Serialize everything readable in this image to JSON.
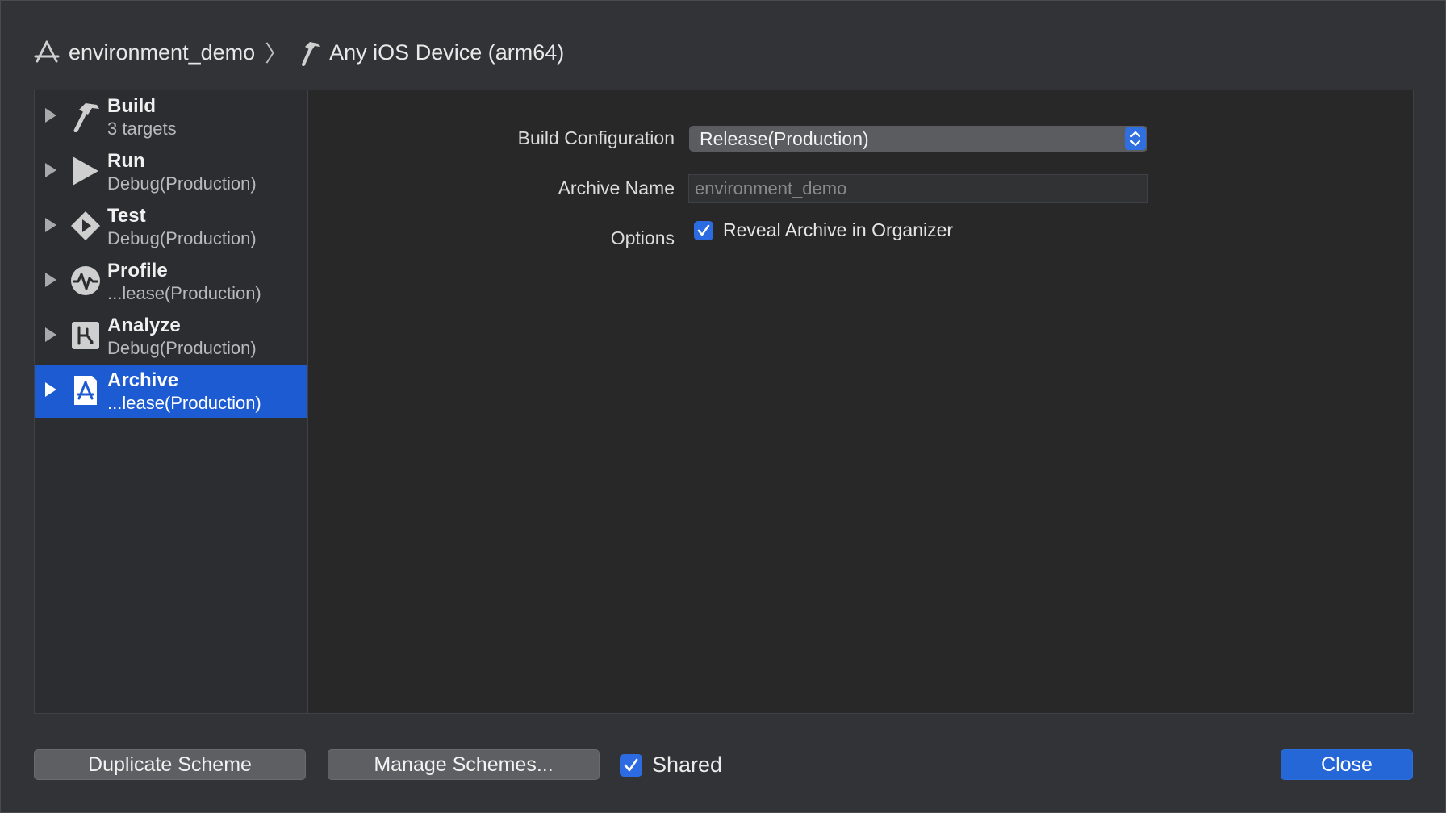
{
  "breadcrumb": {
    "project": "environment_demo",
    "separator": "〉",
    "destination": "Any iOS Device (arm64)"
  },
  "sidebar": {
    "items": [
      {
        "title": "Build",
        "subtitle": "3 targets",
        "icon": "hammer-icon"
      },
      {
        "title": "Run",
        "subtitle": "Debug(Production)",
        "icon": "play-icon"
      },
      {
        "title": "Test",
        "subtitle": "Debug(Production)",
        "icon": "test-diamond-icon"
      },
      {
        "title": "Profile",
        "subtitle": "...lease(Production)",
        "icon": "profile-waveform-icon"
      },
      {
        "title": "Analyze",
        "subtitle": "Debug(Production)",
        "icon": "analyze-icon"
      },
      {
        "title": "Archive",
        "subtitle": "...lease(Production)",
        "icon": "archive-icon",
        "selected": true
      }
    ]
  },
  "main": {
    "build_config_label": "Build Configuration",
    "build_config_value": "Release(Production)",
    "archive_name_label": "Archive Name",
    "archive_name_placeholder": "environment_demo",
    "options_label": "Options",
    "reveal_option_label": "Reveal Archive in Organizer",
    "reveal_option_checked": true
  },
  "footer": {
    "duplicate_label": "Duplicate Scheme",
    "manage_label": "Manage Schemes...",
    "shared_label": "Shared",
    "shared_checked": true,
    "close_label": "Close"
  },
  "colors": {
    "accent": "#2567d6",
    "selection": "#1d5bd2",
    "window_bg": "#323336",
    "panel_bg": "#282829"
  }
}
